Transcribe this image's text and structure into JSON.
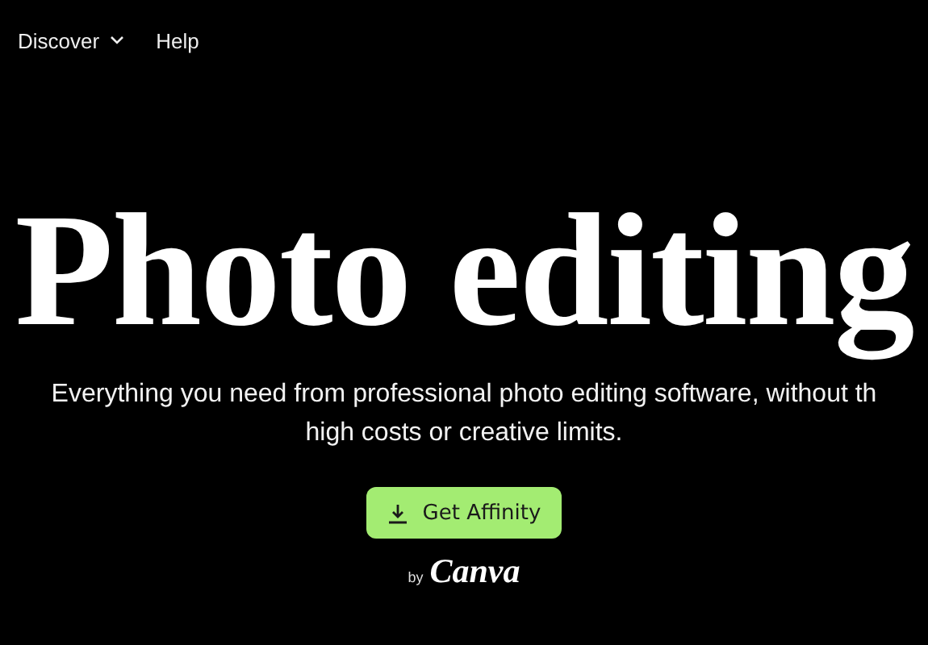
{
  "nav": [
    {
      "label": "Discover",
      "kind": "dropdown"
    },
    {
      "label": "Help",
      "kind": "link"
    }
  ],
  "hero": {
    "title": "Photo editing",
    "subtitle_lines": [
      "Everything you need from professional photo editing software, without th",
      "high costs or creative limits."
    ]
  },
  "cta": {
    "label": "Get Affinity"
  },
  "byline": {
    "prefix": "by",
    "brand": "Canva"
  }
}
